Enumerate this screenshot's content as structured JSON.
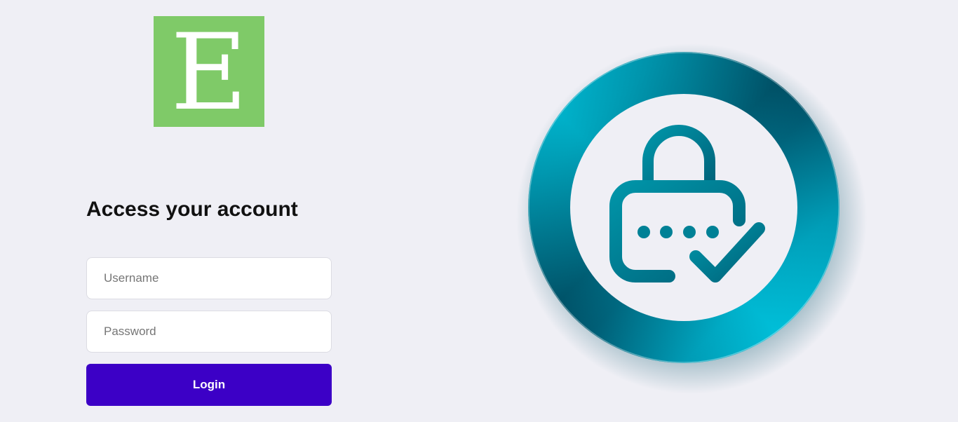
{
  "logo": {
    "letter": "E",
    "background": "#7fca68"
  },
  "login": {
    "heading": "Access your account",
    "username_placeholder": "Username",
    "password_placeholder": "Password",
    "button_label": "Login",
    "button_color": "#3c00c6"
  },
  "illustration": {
    "icon": "lock-password-check-icon",
    "ring_colors": [
      "#00c2e0",
      "#003d52"
    ],
    "icon_color": "#007f96"
  }
}
